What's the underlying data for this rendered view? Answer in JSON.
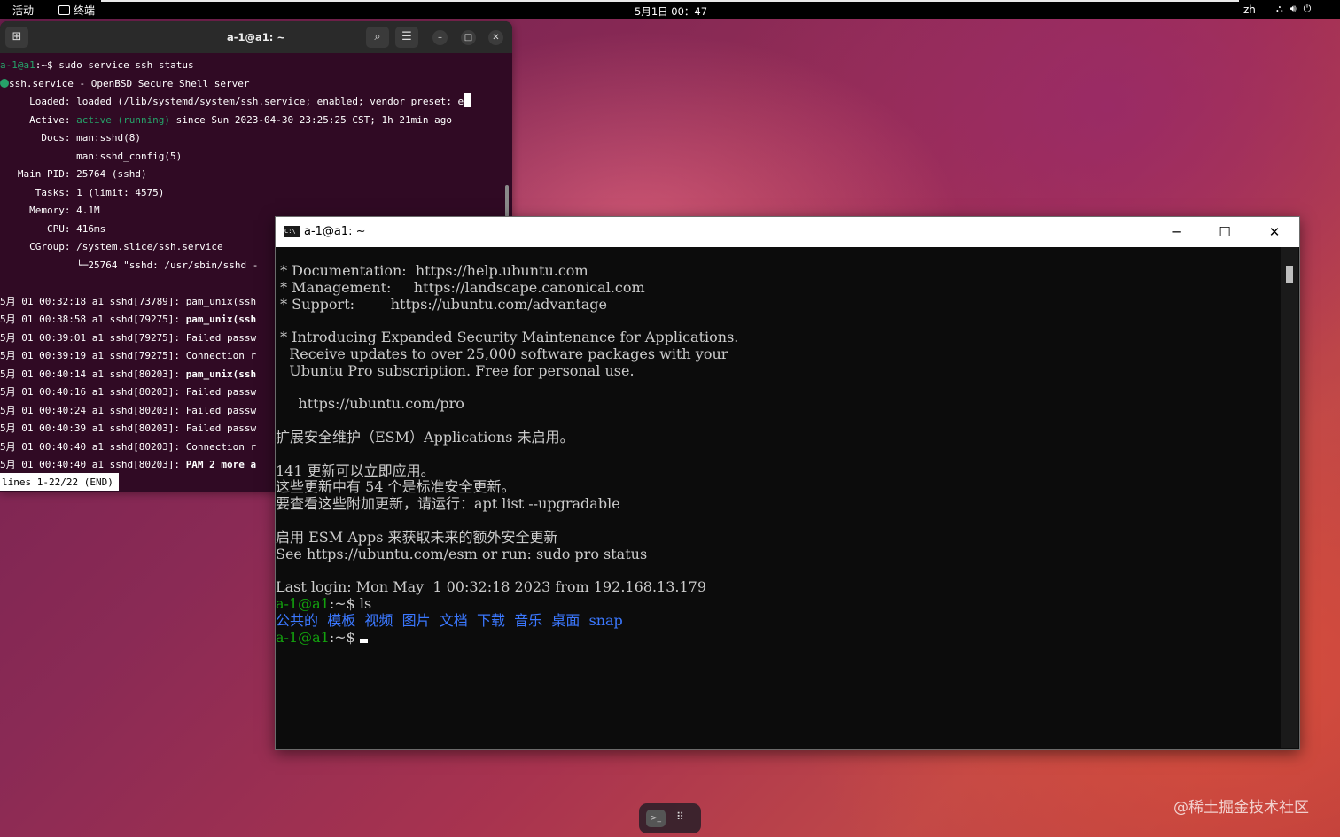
{
  "topbar": {
    "activities": "活动",
    "app_name": "终端",
    "clock": "5月1日 00：47",
    "lang": "zh",
    "tray_icons": [
      "network-icon",
      "volume-icon",
      "power-icon"
    ]
  },
  "ubuntu_terminal": {
    "title": "a-1@a1: ~",
    "prompt_user": "a-1@a1",
    "prompt_rest": ":~$ ",
    "command": "sudo service ssh status",
    "service_line": "ssh.service - OpenBSD Secure Shell server",
    "loaded": "     Loaded: loaded (/lib/systemd/system/ssh.service; enabled; vendor preset: e",
    "active_label": "     Active: ",
    "active_state": "active (running)",
    "active_rest": " since Sun 2023-04-30 23:25:25 CST; 1h 21min ago",
    "docs1": "       Docs: man:sshd(8)",
    "docs2": "             man:sshd_config(5)",
    "pid": "   Main PID: 25764 (sshd)",
    "tasks": "      Tasks: 1 (limit: 4575)",
    "memory": "     Memory: 4.1M",
    "cpu": "        CPU: 416ms",
    "cgroup": "     CGroup: /system.slice/ssh.service",
    "cgroup2": "             └─25764 \"sshd: /usr/sbin/sshd -",
    "log": [
      {
        "prefix": "5月 01 00:32:18 a1 sshd[73789]: ",
        "msg": "pam_unix(ssh",
        "bold": false
      },
      {
        "prefix": "5月 01 00:38:58 a1 sshd[79275]: ",
        "msg": "pam_unix(ssh",
        "bold": true
      },
      {
        "prefix": "5月 01 00:39:01 a1 sshd[79275]: ",
        "msg": "Failed passw",
        "bold": false
      },
      {
        "prefix": "5月 01 00:39:19 a1 sshd[79275]: ",
        "msg": "Connection r",
        "bold": false
      },
      {
        "prefix": "5月 01 00:40:14 a1 sshd[80203]: ",
        "msg": "pam_unix(ssh",
        "bold": true
      },
      {
        "prefix": "5月 01 00:40:16 a1 sshd[80203]: ",
        "msg": "Failed passw",
        "bold": false
      },
      {
        "prefix": "5月 01 00:40:24 a1 sshd[80203]: ",
        "msg": "Failed passw",
        "bold": false
      },
      {
        "prefix": "5月 01 00:40:39 a1 sshd[80203]: ",
        "msg": "Failed passw",
        "bold": false
      },
      {
        "prefix": "5月 01 00:40:40 a1 sshd[80203]: ",
        "msg": "Connection r",
        "bold": false
      },
      {
        "prefix": "5月 01 00:40:40 a1 sshd[80203]: ",
        "msg": "PAM 2 more a",
        "bold": true
      }
    ],
    "status": "lines 1-22/22 (END)"
  },
  "windows_terminal": {
    "title": "a-1@a1: ~",
    "lines": [
      " * Documentation:  https://help.ubuntu.com",
      " * Management:     https://landscape.canonical.com",
      " * Support:        https://ubuntu.com/advantage",
      "",
      " * Introducing Expanded Security Maintenance for Applications.",
      "   Receive updates to over 25,000 software packages with your",
      "   Ubuntu Pro subscription. Free for personal use.",
      "",
      "     https://ubuntu.com/pro",
      "",
      "扩展安全维护（ESM）Applications 未启用。",
      "",
      "141 更新可以立即应用。",
      "这些更新中有 54 个是标准安全更新。",
      "要查看这些附加更新，请运行：apt list --upgradable",
      "",
      "启用 ESM Apps 来获取未来的额外安全更新",
      "See https://ubuntu.com/esm or run: sudo pro status",
      "",
      "Last login: Mon May  1 00:32:18 2023 from 192.168.13.179"
    ],
    "prompt_user": "a-1@a1",
    "prompt_rest": ":~$ ",
    "cmd": "ls",
    "dirs": [
      "公共的",
      "模板",
      "视频",
      "图片",
      "文档",
      "下载",
      "音乐",
      "桌面",
      "snap"
    ]
  },
  "watermark": "@稀土掘金技术社区"
}
